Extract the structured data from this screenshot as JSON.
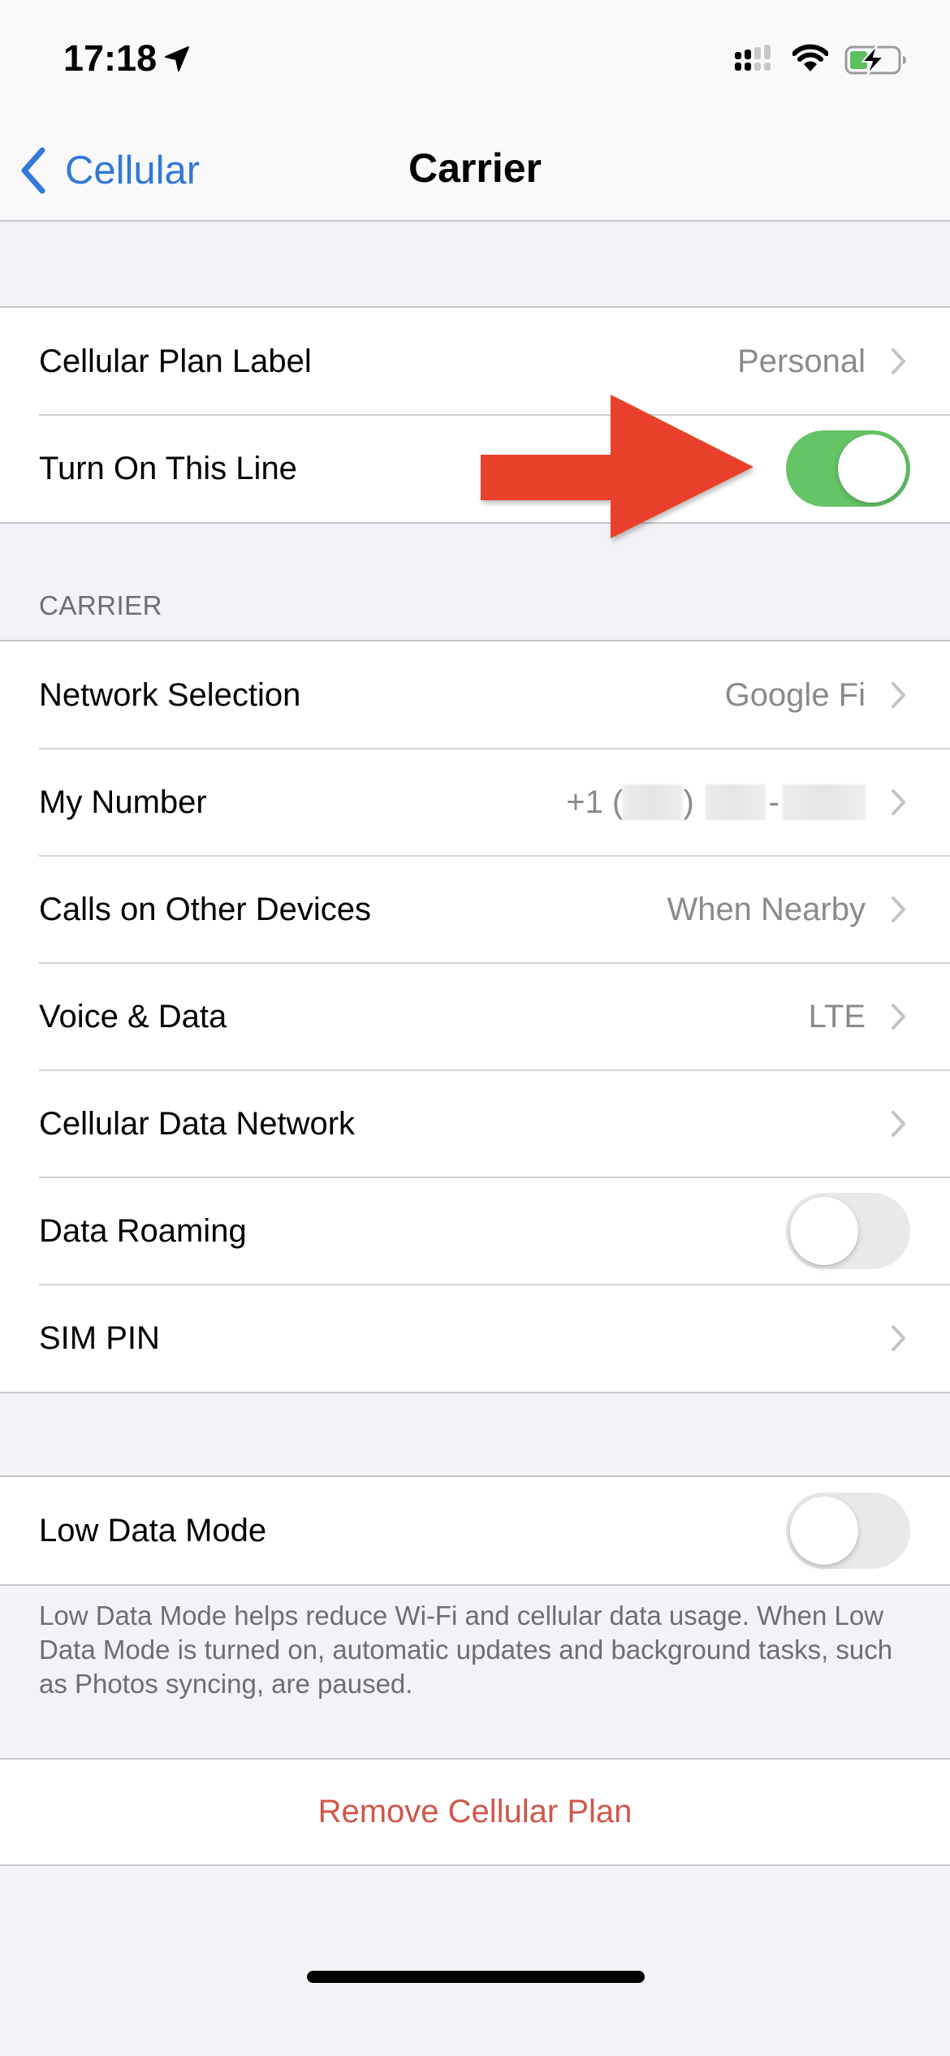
{
  "status_bar": {
    "time": "17:18",
    "icons": [
      "location-arrow-icon",
      "dual-sim-signal-icon",
      "wifi-icon",
      "battery-charging-icon"
    ],
    "signal_bars_filled": 2,
    "signal_bars_total": 4,
    "battery_level_fraction": 0.3,
    "battery_charging": true
  },
  "nav": {
    "back_label": "Cellular",
    "back_icon": "chevron-left-icon",
    "title": "Carrier"
  },
  "plan_group": {
    "rows": [
      {
        "label": "Cellular Plan Label",
        "value": "Personal",
        "accessory": "chevron"
      },
      {
        "label": "Turn On This Line",
        "accessory": "toggle",
        "toggle_on": true
      }
    ]
  },
  "carrier_group": {
    "header": "CARRIER",
    "rows": [
      {
        "label": "Network Selection",
        "value": "Google Fi",
        "accessory": "chevron"
      },
      {
        "label": "My Number",
        "value_prefix": "+1 (",
        "value_redacted": true,
        "value_mid": ")",
        "value_dash": "-",
        "accessory": "chevron"
      },
      {
        "label": "Calls on Other Devices",
        "value": "When Nearby",
        "accessory": "chevron"
      },
      {
        "label": "Voice & Data",
        "value": "LTE",
        "accessory": "chevron"
      },
      {
        "label": "Cellular Data Network",
        "accessory": "chevron"
      },
      {
        "label": "Data Roaming",
        "accessory": "toggle",
        "toggle_on": false
      },
      {
        "label": "SIM PIN",
        "accessory": "chevron"
      }
    ]
  },
  "low_data_group": {
    "rows": [
      {
        "label": "Low Data Mode",
        "accessory": "toggle",
        "toggle_on": false
      }
    ],
    "footer": "Low Data Mode helps reduce Wi-Fi and cellular data usage. When Low Data Mode is turned on, automatic updates and background tasks, such as Photos syncing, are paused."
  },
  "remove_group": {
    "button_label": "Remove Cellular Plan"
  },
  "annotation": {
    "type": "arrow",
    "points_to": "Turn On This Line toggle",
    "color": "#e8412a"
  },
  "colors": {
    "accent_blue": "#3478d8",
    "toggle_on_green": "#65c466",
    "destructive_red": "#d0574a",
    "secondary_text": "#8a8a8e",
    "background": "#f2f2f7"
  }
}
